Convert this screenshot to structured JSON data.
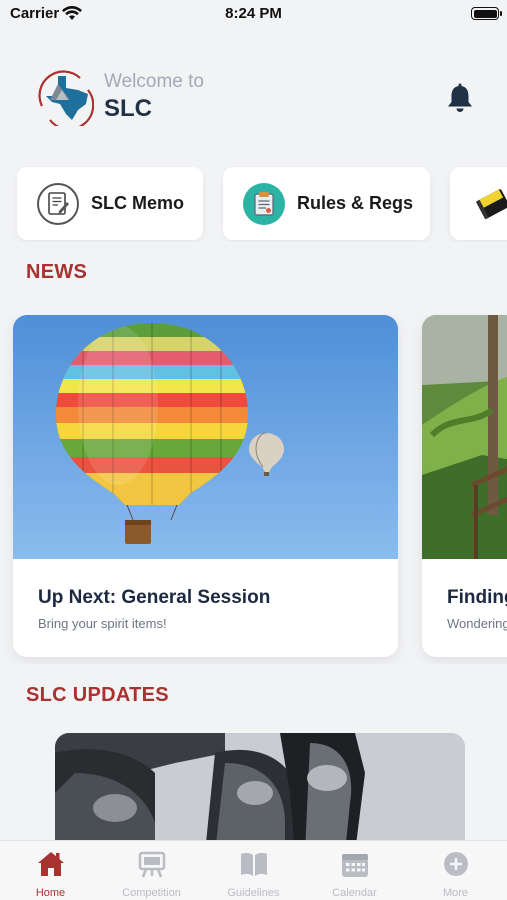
{
  "status_bar": {
    "carrier": "Carrier",
    "time": "8:24 PM"
  },
  "header": {
    "welcome": "Welcome to",
    "title": "SLC"
  },
  "quick_links": [
    {
      "label": "SLC Memo",
      "icon": "memo-document-icon"
    },
    {
      "label": "Rules & Regs",
      "icon": "clipboard-icon"
    },
    {
      "label": "",
      "icon": "notebook-icon"
    }
  ],
  "sections": {
    "news": "NEWS",
    "updates": "SLC UPDATES"
  },
  "news": [
    {
      "title": "Up Next: General Session",
      "subtitle": "Bring your spirit items!",
      "image": "hot-air-balloons"
    },
    {
      "title": "Finding",
      "subtitle": "Wondering",
      "image": "tropical-path"
    }
  ],
  "tabs": [
    {
      "label": "Home",
      "icon": "home-icon",
      "active": true
    },
    {
      "label": "Competition",
      "icon": "easel-icon",
      "active": false
    },
    {
      "label": "Guidelines",
      "icon": "book-icon",
      "active": false
    },
    {
      "label": "Calendar",
      "icon": "calendar-icon",
      "active": false
    },
    {
      "label": "More",
      "icon": "plus-circle-icon",
      "active": false
    }
  ],
  "colors": {
    "accent": "#a8322f",
    "background": "#f2f3f5",
    "title": "#1f3144"
  }
}
